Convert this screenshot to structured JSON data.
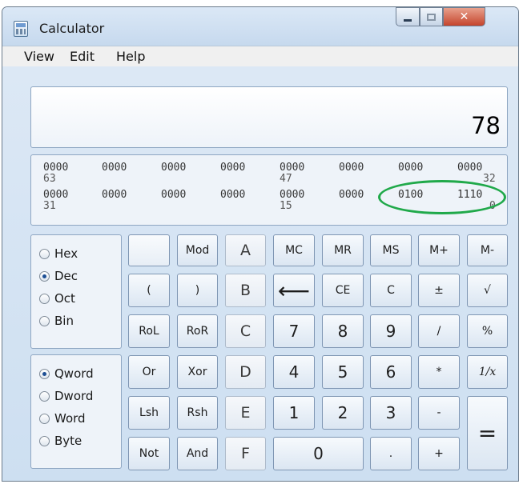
{
  "window": {
    "title": "Calculator"
  },
  "menu": {
    "view": "View",
    "edit": "Edit",
    "help": "Help"
  },
  "display": {
    "value": "78"
  },
  "bits": {
    "row1": [
      "0000",
      "0000",
      "0000",
      "0000",
      "0000",
      "0000",
      "0000",
      "0000"
    ],
    "row1_index": [
      "63",
      "47",
      "32"
    ],
    "row2": [
      "0000",
      "0000",
      "0000",
      "0000",
      "0000",
      "0000",
      "0100",
      "1110"
    ],
    "row2_index": [
      "31",
      "15",
      "0"
    ]
  },
  "radix": {
    "hex": "Hex",
    "dec": "Dec",
    "oct": "Oct",
    "bin": "Bin",
    "selected": "Dec"
  },
  "wordsize": {
    "qword": "Qword",
    "dword": "Dword",
    "word": "Word",
    "byte": "Byte",
    "selected": "Qword"
  },
  "keys": {
    "blank": "",
    "mod": "Mod",
    "a": "A",
    "mc": "MC",
    "mr": "MR",
    "ms": "MS",
    "mplus": "M+",
    "mminus": "M-",
    "lparen": "(",
    "rparen": ")",
    "b": "B",
    "backspace": "⟵",
    "ce": "CE",
    "c": "C",
    "plusminus": "±",
    "sqrt": "√",
    "rol": "RoL",
    "ror": "RoR",
    "hexc": "C",
    "n7": "7",
    "n8": "8",
    "n9": "9",
    "divide": "/",
    "percent": "%",
    "or": "Or",
    "xor": "Xor",
    "d": "D",
    "n4": "4",
    "n5": "5",
    "n6": "6",
    "multiply": "*",
    "reciprocal": "1/x",
    "lsh": "Lsh",
    "rsh": "Rsh",
    "e": "E",
    "n1": "1",
    "n2": "2",
    "n3": "3",
    "minus": "-",
    "equals": "=",
    "not": "Not",
    "and": "And",
    "f": "F",
    "n0": "0",
    "dot": ".",
    "plus": "+"
  }
}
